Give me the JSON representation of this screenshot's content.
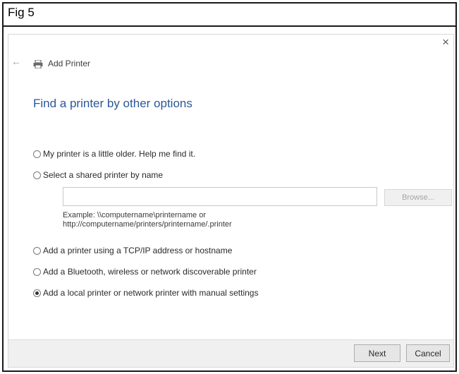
{
  "figure": {
    "label": "Fig 5"
  },
  "dialog": {
    "close_glyph": "×",
    "back_glyph": "←",
    "title": "Add Printer",
    "heading": "Find a printer by other options",
    "options": [
      {
        "label": "My printer is a little older. Help me find it.",
        "selected": false
      },
      {
        "label": "Select a shared printer by name",
        "selected": false
      },
      {
        "label": "Add a printer using a TCP/IP address or hostname",
        "selected": false
      },
      {
        "label": "Add a Bluetooth, wireless or network discoverable printer",
        "selected": false
      },
      {
        "label": "Add a local printer or network printer with manual settings",
        "selected": true
      }
    ],
    "shared_printer_input": {
      "value": "",
      "placeholder": ""
    },
    "browse_label": "Browse...",
    "example_line1": "Example: \\\\computername\\printername or",
    "example_line2": "http://computername/printers/printername/.printer",
    "next_label": "Next",
    "cancel_label": "Cancel"
  },
  "colors": {
    "heading": "#2b5797",
    "footer": "#f0f0f0",
    "frame_border": "#1a1a1a"
  }
}
